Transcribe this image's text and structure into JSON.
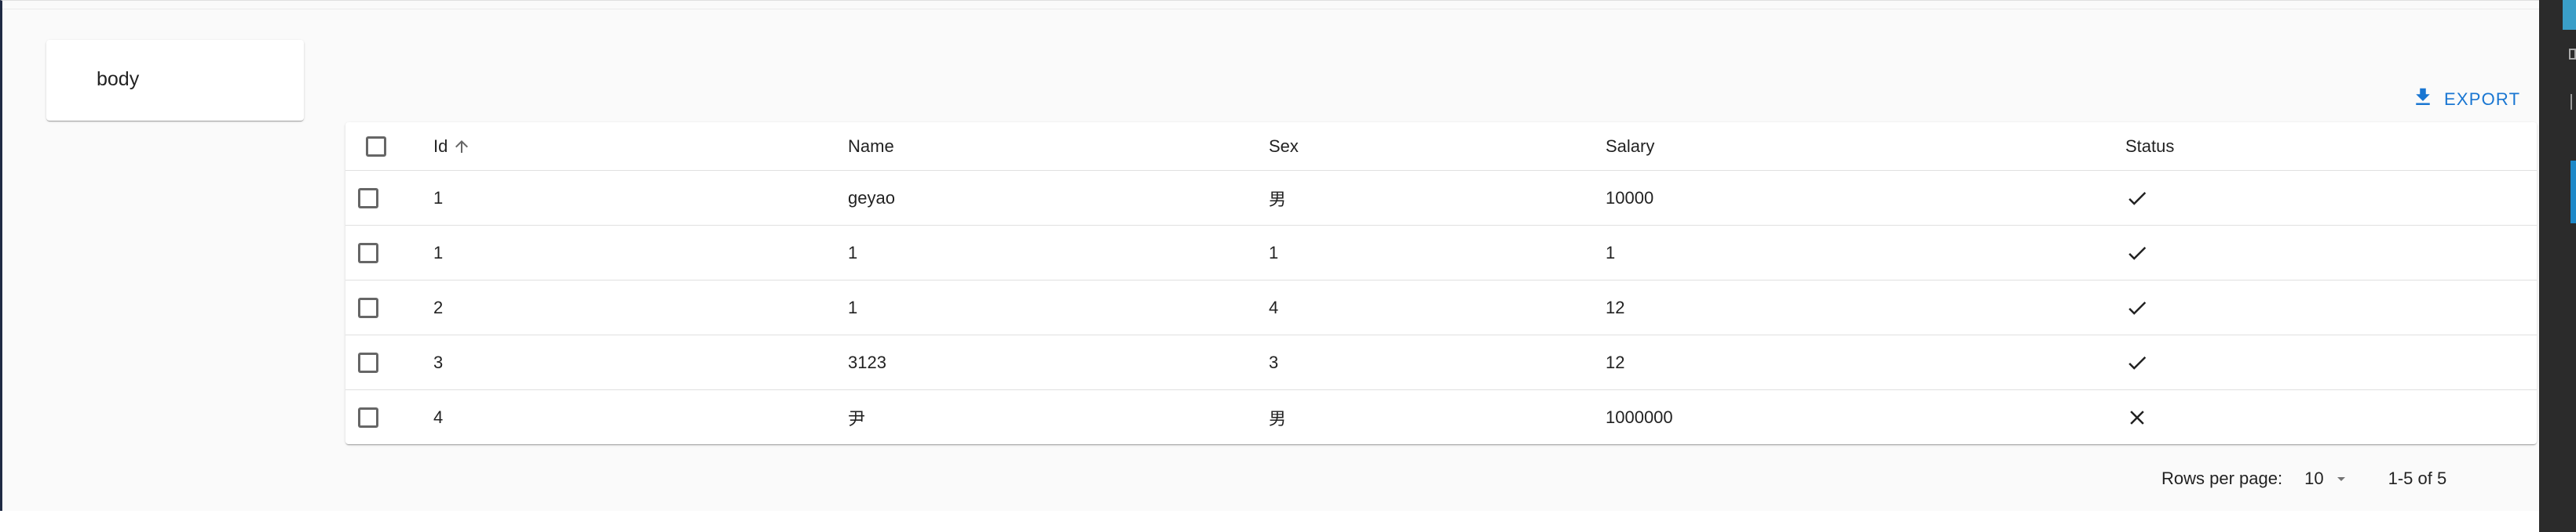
{
  "card": {
    "label": "body"
  },
  "toolbar": {
    "export_label": "EXPORT",
    "export_icon": "download-icon"
  },
  "table": {
    "columns": [
      "Id",
      "Name",
      "Sex",
      "Salary",
      "Status"
    ],
    "sort_column": "Id",
    "sort_icon": "arrow-up-icon",
    "rows": [
      {
        "id": "1",
        "name": "geyao",
        "sex": "男",
        "salary": "10000",
        "status": "check"
      },
      {
        "id": "1",
        "name": "1",
        "sex": "1",
        "salary": "1",
        "status": "check"
      },
      {
        "id": "2",
        "name": "1",
        "sex": "4",
        "salary": "12",
        "status": "check"
      },
      {
        "id": "3",
        "name": "3123",
        "sex": "3",
        "salary": "12",
        "status": "check"
      },
      {
        "id": "4",
        "name": "尹",
        "sex": "男",
        "salary": "1000000",
        "status": "cross"
      }
    ]
  },
  "pagination": {
    "rows_per_page_label": "Rows per page:",
    "rows_per_page_value": "10",
    "range": "1-5 of 5"
  },
  "colors": {
    "accent": "#1976d2",
    "divider": "#e0e0e0",
    "background": "#fafafa"
  }
}
